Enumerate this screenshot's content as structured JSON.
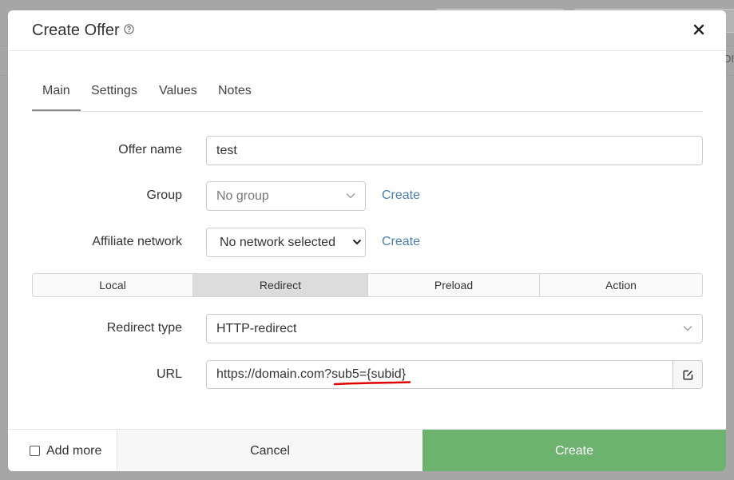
{
  "modal": {
    "title": "Create Offer",
    "tabs": [
      {
        "label": "Main",
        "active": true
      },
      {
        "label": "Settings",
        "active": false
      },
      {
        "label": "Values",
        "active": false
      },
      {
        "label": "Notes",
        "active": false
      }
    ],
    "fields": {
      "offer_name": {
        "label": "Offer name",
        "value": "test"
      },
      "group": {
        "label": "Group",
        "value": "No group",
        "create_link": "Create"
      },
      "affiliate_network": {
        "label": "Affiliate network",
        "value": "No network selected",
        "create_link": "Create"
      },
      "redirect_type": {
        "label": "Redirect type",
        "value": "HTTP-redirect"
      },
      "url": {
        "label": "URL",
        "value": "https://domain.com?sub5={subid}"
      }
    },
    "mode_segments": [
      {
        "label": "Local",
        "active": false
      },
      {
        "label": "Redirect",
        "active": true
      },
      {
        "label": "Preload",
        "active": false
      },
      {
        "label": "Action",
        "active": false
      }
    ],
    "footer": {
      "add_more_label": "Add more",
      "add_more_checked": false,
      "cancel_label": "Cancel",
      "create_label": "Create"
    }
  },
  "colors": {
    "create_button": "#6db26f",
    "link": "#4a7ea8",
    "annotation_underline": "#e00000"
  },
  "background": {
    "partial_text": "DI"
  }
}
